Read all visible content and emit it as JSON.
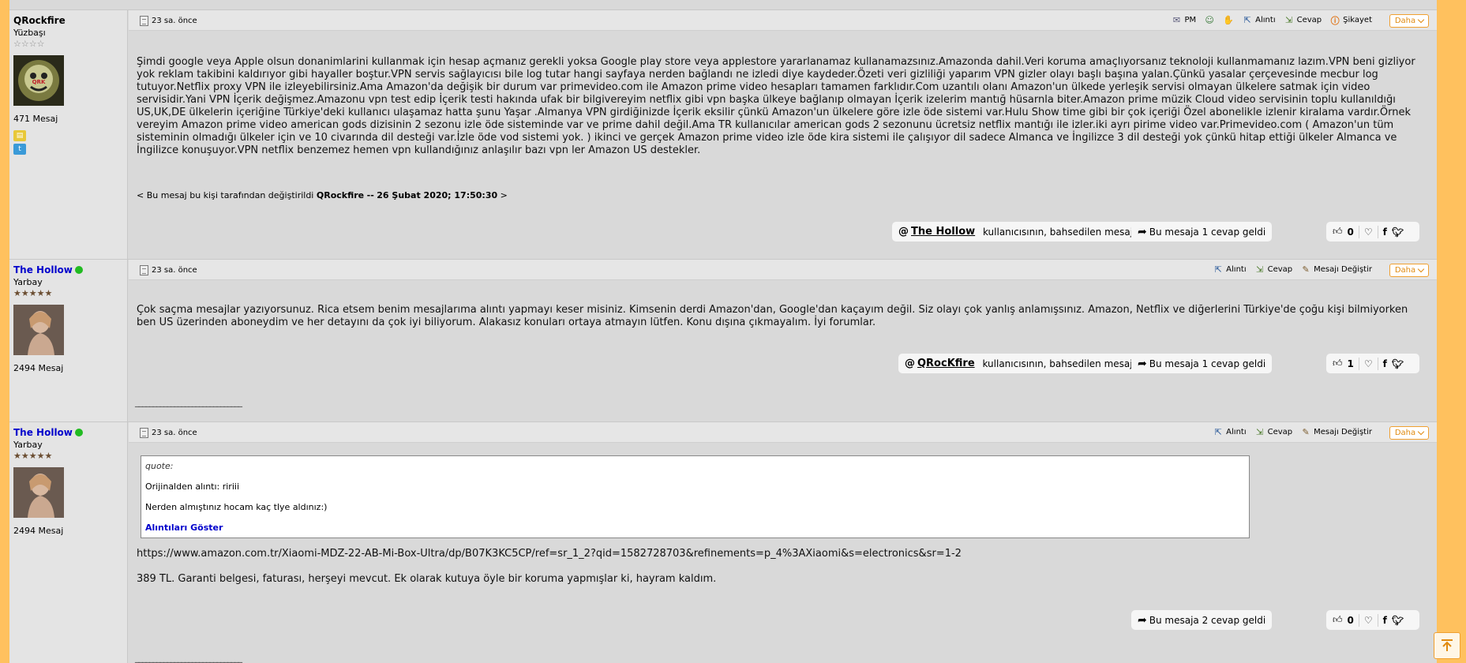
{
  "posts": [
    {
      "author": "QRockfire",
      "rank": "Yüzbaşı",
      "stars": "☆☆☆☆",
      "message_count": "471 Mesaj",
      "time": "23 sa. önce",
      "actions": [
        "PM",
        "",
        "",
        "Alıntı",
        "Cevap",
        "Şikayet"
      ],
      "more": "Daha",
      "body": "Şimdi google veya Apple olsun donanimlarini kullanmak için hesap açmanız gerekli yoksa Google play store veya applestore yararlanamaz kullanamazsınız.Amazonda dahil.Veri koruma amaçlıyorsanız teknoloji kullanmamanız lazım.VPN beni gizliyor yok reklam takibini kaldırıyor gibi hayaller boştur.VPN servis sağlayıcısı bile log tutar hangi sayfaya nerden bağlandı ne izledi diye kaydeder.Özeti veri gizliliği yaparım VPN gizler olayı başlı başına yalan.Çünkü yasalar çerçevesinde mecbur log tutuyor.Netflix proxy VPN ile izleyebilirsiniz.Ama Amazon'da değişik bir durum var primevideo.com ile Amazon prime video hesapları tamamen farklıdır.Com uzantılı olanı Amazon'un ülkede yerleşik servisi olmayan ülkelere satmak için video servisidir.Yani VPN İçerik değişmez.Amazonu vpn test edip İçerik testi hakında ufak bir bilgivereyim netflix gibi vpn başka ülkeye bağlanıp olmayan İçerik izelerim mantığ hüsarnla biter.Amazon prime müzik Cloud video servisinin toplu kullanıldığı US,UK,DE ülkelerin içeriğine Türkiye'deki kullanıcı ulaşamaz hatta şunu Yaşar .Almanya VPN girdiğinizde İçerik eksilir çünkü Amazon'un ülkelere göre izle öde sistemi var.Hulu Show time gibi bir çok içeriği Özel abonelikle izlenir kiralama vardır.Örnek vereyim Amazon prime video american gods dizisinin 2 sezonu izle öde sisteminde var ve prime dahil değil.Ama TR kullanıcılar american gods 2 sezonunu ücretsiz netflix mantığı ile izler.iki ayrı pirime video var.Primevideo.com ( Amazon'un tüm sisteminin olmadığı ülkeler için ve 10 civarında dil desteği var.İzle öde vod sistemi yok. ) ikinci ve gerçek Amazon prime video izle öde kira sistemi ile çalışıyor dil sadece Almanca ve İngilizce 3 dil desteği yok çünkü hitap ettiği ülkeler Almanca ve İngilizce konuşuyor.VPN netflix benzemez hemen vpn kullandığınız anlaşılır bazı vpn ler Amazon US destekler.",
      "edit_prefix": "< Bu mesaj bu kişi tarafından değiştirildi",
      "edit_user": "QRockfire",
      "edit_sep": "--",
      "edit_date": "26 Şubat 2020; 17:50:30",
      "edit_suffix": ">",
      "mention_at": "@",
      "mention_user": "The Hollow",
      "mention_text": "kullanıcısının, bahsedilen mesajını gör",
      "replies": "Bu mesaja 1 cevap geldi",
      "likes": "0"
    },
    {
      "author": "The Hollow",
      "rank": "Yarbay",
      "stars": "★★★★★",
      "message_count": "2494 Mesaj",
      "time": "23 sa. önce",
      "actions": [
        "Alıntı",
        "Cevap",
        "Mesajı Değiştir"
      ],
      "more": "Daha",
      "body": "Çok saçma mesajlar yazıyorsunuz. Rica etsem benim mesajlarıma alıntı yapmayı keser misiniz. Kimsenin derdi Amazon'dan, Google'dan kaçayım değil. Siz olayı çok yanlış anlamışsınız. Amazon, Netflix ve diğerlerini Türkiye'de çoğu kişi bilmiyorken ben US üzerinden aboneydim ve her detayını da çok iyi biliyorum. Alakasız konuları ortaya atmayın lütfen. Konu dışına çıkmayalım. İyi forumlar.",
      "mention_at": "@",
      "mention_user": "QRocKfire",
      "mention_text": "kullanıcısının, bahsedilen mesajını gör",
      "replies": "Bu mesaja 1 cevap geldi",
      "likes": "1",
      "signature": "______________________________"
    },
    {
      "author": "The Hollow",
      "rank": "Yarbay",
      "stars": "★★★★★",
      "message_count": "2494 Mesaj",
      "time": "23 sa. önce",
      "actions": [
        "Alıntı",
        "Cevap",
        "Mesajı Değiştir"
      ],
      "more": "Daha",
      "quote_label": "quote:",
      "quote_source": "Orijinalden alıntı: ririii",
      "quote_text": "Nerden almıştınız hocam kaç tlye aldınız:)",
      "quote_show": "Alıntıları Göster",
      "link": "https://www.amazon.com.tr/Xiaomi-MDZ-22-AB-Mi-Box-Ultra/dp/B07K3KC5CP/ref=sr_1_2?qid=1582728703&refinements=p_4%3AXiaomi&s=electronics&sr=1-2",
      "body": "389 TL. Garanti belgesi, faturası, herşeyi mevcut. Ek olarak kutuya öyle bir koruma yapmışlar ki, hayram kaldım.",
      "replies": "Bu mesaja 2 cevap geldi",
      "likes": "0",
      "signature": "______________________________"
    }
  ],
  "icons": {
    "share": "arrow-share-icon",
    "like": "thumbs-up-icon",
    "fav": "heart-icon",
    "facebook": "facebook-icon",
    "twitter": "twitter-icon",
    "top": "scroll-top-icon"
  },
  "colors": {
    "accent": "#f0a030",
    "background": "#ffc15e",
    "link": "#0000cc"
  }
}
